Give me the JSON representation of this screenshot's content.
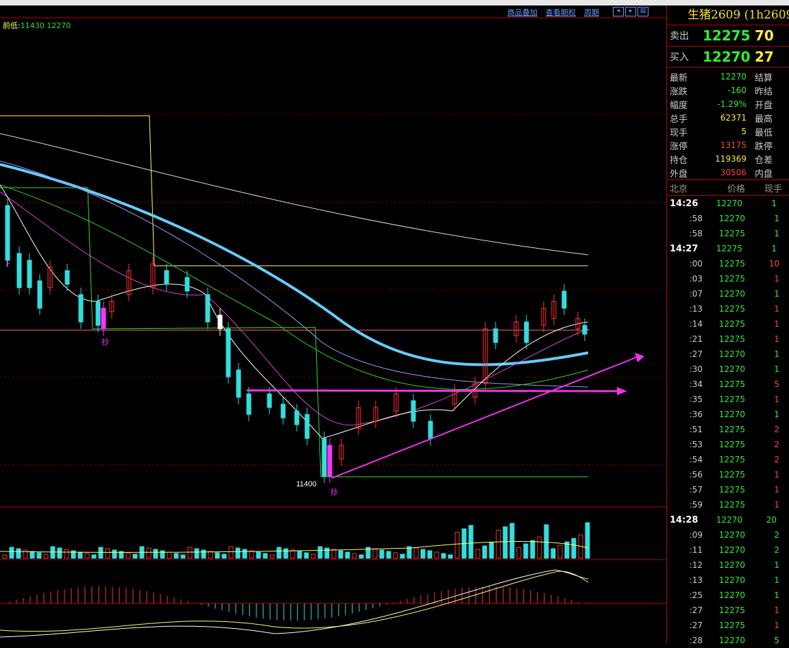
{
  "toolbar": {
    "overlay": "商品叠加",
    "options": "查看期权",
    "period": "周期"
  },
  "prev_low": {
    "label": "前低:",
    "value1": "11430",
    "value2": "12270"
  },
  "chart": {
    "low_label": "11400",
    "buy_marker": "抄",
    "down_marker": "卜"
  },
  "colors": {
    "up": "#ff3333",
    "down": "#33dddd",
    "ma_thick": "#66ccff",
    "arrow": "#ff33ff"
  },
  "panel": {
    "title": "生猪2609 (1h2609",
    "sell": {
      "label": "卖出",
      "price": "12275",
      "qty": "70"
    },
    "buy": {
      "label": "买入",
      "price": "12270",
      "qty": "27"
    },
    "stats": [
      {
        "a": "最新",
        "b": "12270",
        "c": "结算",
        "color": "#33ee33"
      },
      {
        "a": "涨跌",
        "b": "-160",
        "c": "昨结",
        "color": "#33ee33"
      },
      {
        "a": "幅度",
        "b": "-1.29%",
        "c": "开盘",
        "color": "#33ee33"
      },
      {
        "a": "总手",
        "b": "62371",
        "c": "最高",
        "color": "#ffee33"
      },
      {
        "a": "现手",
        "b": "5",
        "c": "最低",
        "color": "#ffee33"
      },
      {
        "a": "涨停",
        "b": "13175",
        "c": "跌停",
        "color": "#ff4444"
      },
      {
        "a": "持仓",
        "b": "119369",
        "c": "仓差",
        "color": "#ffee33"
      },
      {
        "a": "外盘",
        "b": "30506",
        "c": "内盘",
        "color": "#ff4444"
      }
    ],
    "table_head": {
      "time": "北京",
      "price": "价格",
      "qty": "现手"
    },
    "ticks": [
      {
        "t": "14:26",
        "p": "12270",
        "q": "1",
        "big": true
      },
      {
        "t": ":58",
        "p": "12270",
        "q": "1"
      },
      {
        "t": ":58",
        "p": "12275",
        "q": "1"
      },
      {
        "t": "14:27",
        "p": "12275",
        "q": "1",
        "big": true
      },
      {
        "t": ":00",
        "p": "12275",
        "q": "10",
        "qc": "#ff4444"
      },
      {
        "t": ":03",
        "p": "12275",
        "q": "1",
        "qc": "#ff4444"
      },
      {
        "t": ":07",
        "p": "12270",
        "q": "1"
      },
      {
        "t": ":13",
        "p": "12275",
        "q": "1",
        "qc": "#ff4444"
      },
      {
        "t": ":14",
        "p": "12275",
        "q": "1",
        "qc": "#ff4444"
      },
      {
        "t": ":21",
        "p": "12275",
        "q": "1",
        "qc": "#ff4444"
      },
      {
        "t": ":27",
        "p": "12270",
        "q": "1"
      },
      {
        "t": ":30",
        "p": "12270",
        "q": "1"
      },
      {
        "t": ":34",
        "p": "12275",
        "q": "5",
        "qc": "#ff4444"
      },
      {
        "t": ":35",
        "p": "12275",
        "q": "1",
        "qc": "#ff4444"
      },
      {
        "t": ":36",
        "p": "12270",
        "q": "1"
      },
      {
        "t": ":51",
        "p": "12275",
        "q": "2",
        "qc": "#ff4444"
      },
      {
        "t": ":53",
        "p": "12275",
        "q": "2",
        "qc": "#ff4444"
      },
      {
        "t": ":54",
        "p": "12275",
        "q": "2",
        "qc": "#ff4444"
      },
      {
        "t": ":56",
        "p": "12275",
        "q": "1",
        "qc": "#ff4444"
      },
      {
        "t": ":57",
        "p": "12275",
        "q": "1",
        "qc": "#ff4444"
      },
      {
        "t": ":59",
        "p": "12275",
        "q": "1",
        "qc": "#ff4444"
      },
      {
        "t": "14:28",
        "p": "12270",
        "q": "20",
        "big": true
      },
      {
        "t": ":09",
        "p": "12270",
        "q": "2"
      },
      {
        "t": ":11",
        "p": "12270",
        "q": "2"
      },
      {
        "t": ":12",
        "p": "12270",
        "q": "1"
      },
      {
        "t": ":13",
        "p": "12270",
        "q": "1"
      },
      {
        "t": ":25",
        "p": "12270",
        "q": "1"
      },
      {
        "t": ":27",
        "p": "12275",
        "q": "1",
        "qc": "#ff4444"
      },
      {
        "t": ":27",
        "p": "12275",
        "q": "1",
        "qc": "#ff4444"
      },
      {
        "t": ":28",
        "p": "12270",
        "q": "5"
      }
    ]
  }
}
